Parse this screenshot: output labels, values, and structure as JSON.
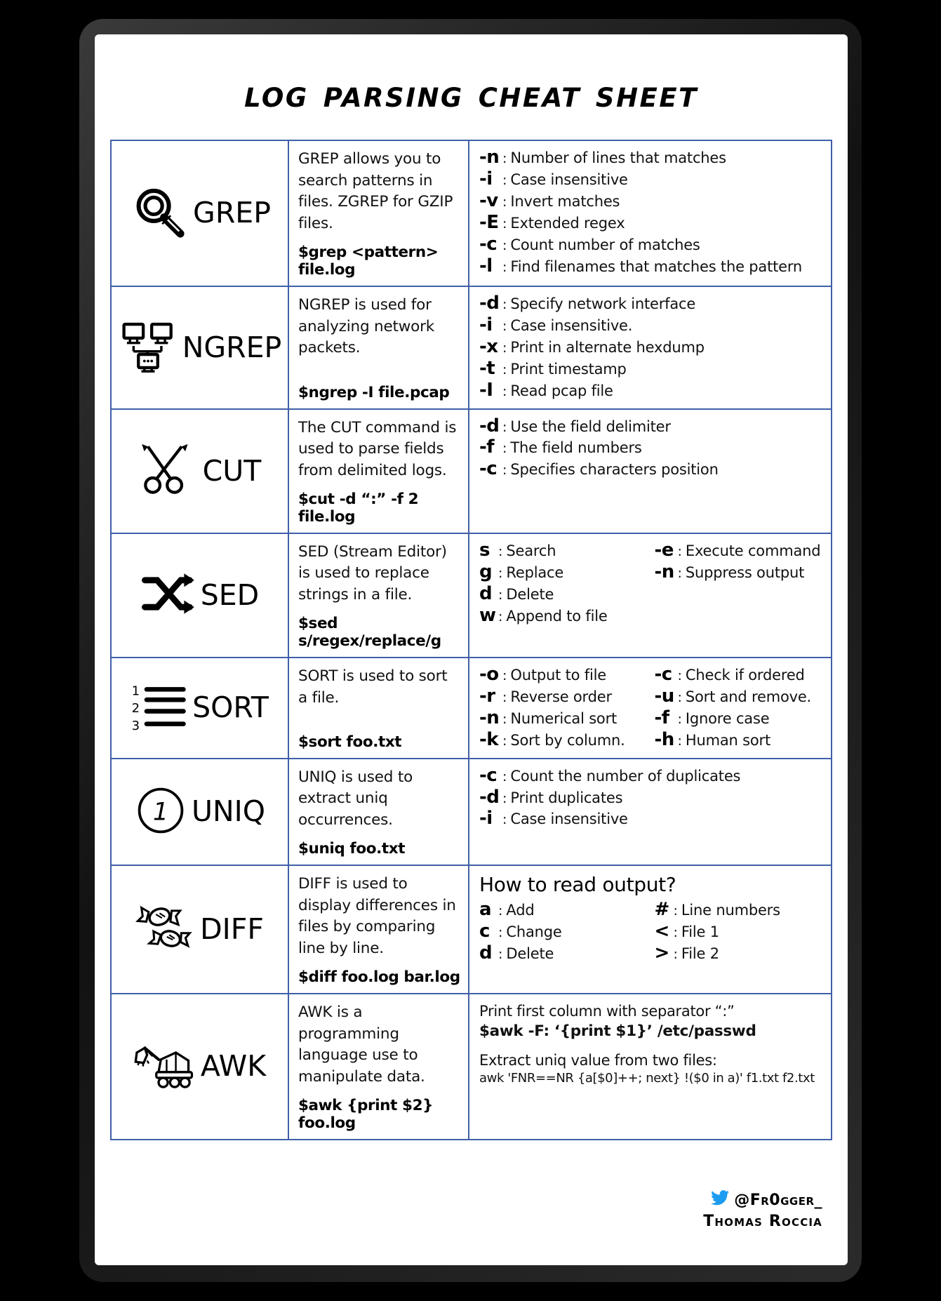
{
  "page": {
    "title": "Log Parsing Cheat Sheet",
    "border_color": "#3f5fa8",
    "accent_color": "#1d9bf0"
  },
  "rows": [
    {
      "icon": "magnifier-icon",
      "name": "GREP",
      "description": "GREP allows you to search patterns in files. ZGREP for GZIP files.",
      "command": "$grep <pattern> file.log",
      "options": [
        {
          "flag": "-n",
          "text": "Number of lines that matches"
        },
        {
          "flag": "-i",
          "text": "Case insensitive"
        },
        {
          "flag": "-v",
          "text": "Invert matches"
        },
        {
          "flag": "-E",
          "text": "Extended regex"
        },
        {
          "flag": "-c",
          "text": "Count number of matches"
        },
        {
          "flag": "-l",
          "text": "Find filenames that matches the pattern"
        }
      ]
    },
    {
      "icon": "network-computers-icon",
      "name": "NGREP",
      "description": "NGREP is used for analyzing network packets.",
      "command": "$ngrep -I file.pcap",
      "options": [
        {
          "flag": "-d",
          "text": "Specify network interface"
        },
        {
          "flag": "-i",
          "text": "Case insensitive."
        },
        {
          "flag": "-x",
          "text": "Print in alternate hexdump"
        },
        {
          "flag": "-t",
          "text": "Print timestamp"
        },
        {
          "flag": "-I",
          "text": "Read pcap file"
        }
      ]
    },
    {
      "icon": "scissors-icon",
      "name": "CUT",
      "description": "The CUT command is used to parse fields from delimited logs.",
      "command": "$cut -d “:” -f 2 file.log",
      "options": [
        {
          "flag": "-d",
          "text": "Use the field delimiter"
        },
        {
          "flag": "-f",
          "text": "The field numbers"
        },
        {
          "flag": "-c",
          "text": "Specifies characters position"
        }
      ]
    },
    {
      "icon": "shuffle-arrows-icon",
      "name": "SED",
      "description": "SED (Stream Editor) is used to replace strings in a file.",
      "command": "$sed s/regex/replace/g",
      "two_column_options": true,
      "options": [
        {
          "flag": "s",
          "text": "Search"
        },
        {
          "flag": "-e",
          "text": "Execute command"
        },
        {
          "flag": "g",
          "text": "Replace"
        },
        {
          "flag": "-n",
          "text": "Suppress output"
        },
        {
          "flag": "d",
          "text": "Delete"
        },
        {
          "flag": "",
          "text": ""
        },
        {
          "flag": "w",
          "text": "Append to file"
        },
        {
          "flag": "",
          "text": ""
        }
      ]
    },
    {
      "icon": "numbered-list-icon",
      "name": "SORT",
      "description": "SORT is used to sort a file.",
      "command": "$sort foo.txt",
      "two_column_options": true,
      "options": [
        {
          "flag": "-o",
          "text": "Output to file"
        },
        {
          "flag": "-c",
          "text": "Check if ordered"
        },
        {
          "flag": "-r",
          "text": "Reverse order"
        },
        {
          "flag": "-u",
          "text": "Sort and remove."
        },
        {
          "flag": "-n",
          "text": "Numerical sort"
        },
        {
          "flag": "-f",
          "text": "Ignore case"
        },
        {
          "flag": "-k",
          "text": "Sort by column."
        },
        {
          "flag": "-h",
          "text": "Human sort"
        }
      ]
    },
    {
      "icon": "circled-one-icon",
      "name": "UNIQ",
      "description": "UNIQ is used to extract uniq occurrences.",
      "command": "$uniq foo.txt",
      "options": [
        {
          "flag": "-c",
          "text": "Count the number of duplicates"
        },
        {
          "flag": "-d",
          "text": "Print duplicates"
        },
        {
          "flag": "-i",
          "text": "Case insensitive"
        }
      ]
    },
    {
      "icon": "candies-icon",
      "name": "DIFF",
      "description": "DIFF is used to display differences in files by comparing line by line.",
      "command": "$diff foo.log bar.log",
      "options_heading": "How to read output?",
      "two_column_options": true,
      "options": [
        {
          "flag": "a",
          "text": "Add"
        },
        {
          "flag": "#",
          "text": "Line numbers"
        },
        {
          "flag": "c",
          "text": "Change"
        },
        {
          "flag": "<",
          "text": "File 1"
        },
        {
          "flag": "d",
          "text": "Delete"
        },
        {
          "flag": ">",
          "text": "File 2"
        }
      ]
    },
    {
      "icon": "excavator-icon",
      "name": "AWK",
      "description": "AWK is a programming language use to manipulate data.",
      "command": "$awk {print $2} foo.log",
      "awk_block": {
        "line1": "Print first column with separator “:”",
        "line2": "$awk -F: ‘{print $1}’ /etc/passwd",
        "line3": "Extract uniq value from two files:",
        "line4": "awk 'FNR==NR {a[$0]++; next} !($0 in a)' f1.txt f2.txt"
      }
    }
  ],
  "footer": {
    "twitter_icon": "twitter-bird-icon",
    "handle": "@Fr0gger_",
    "author": "Thomas Roccia"
  }
}
